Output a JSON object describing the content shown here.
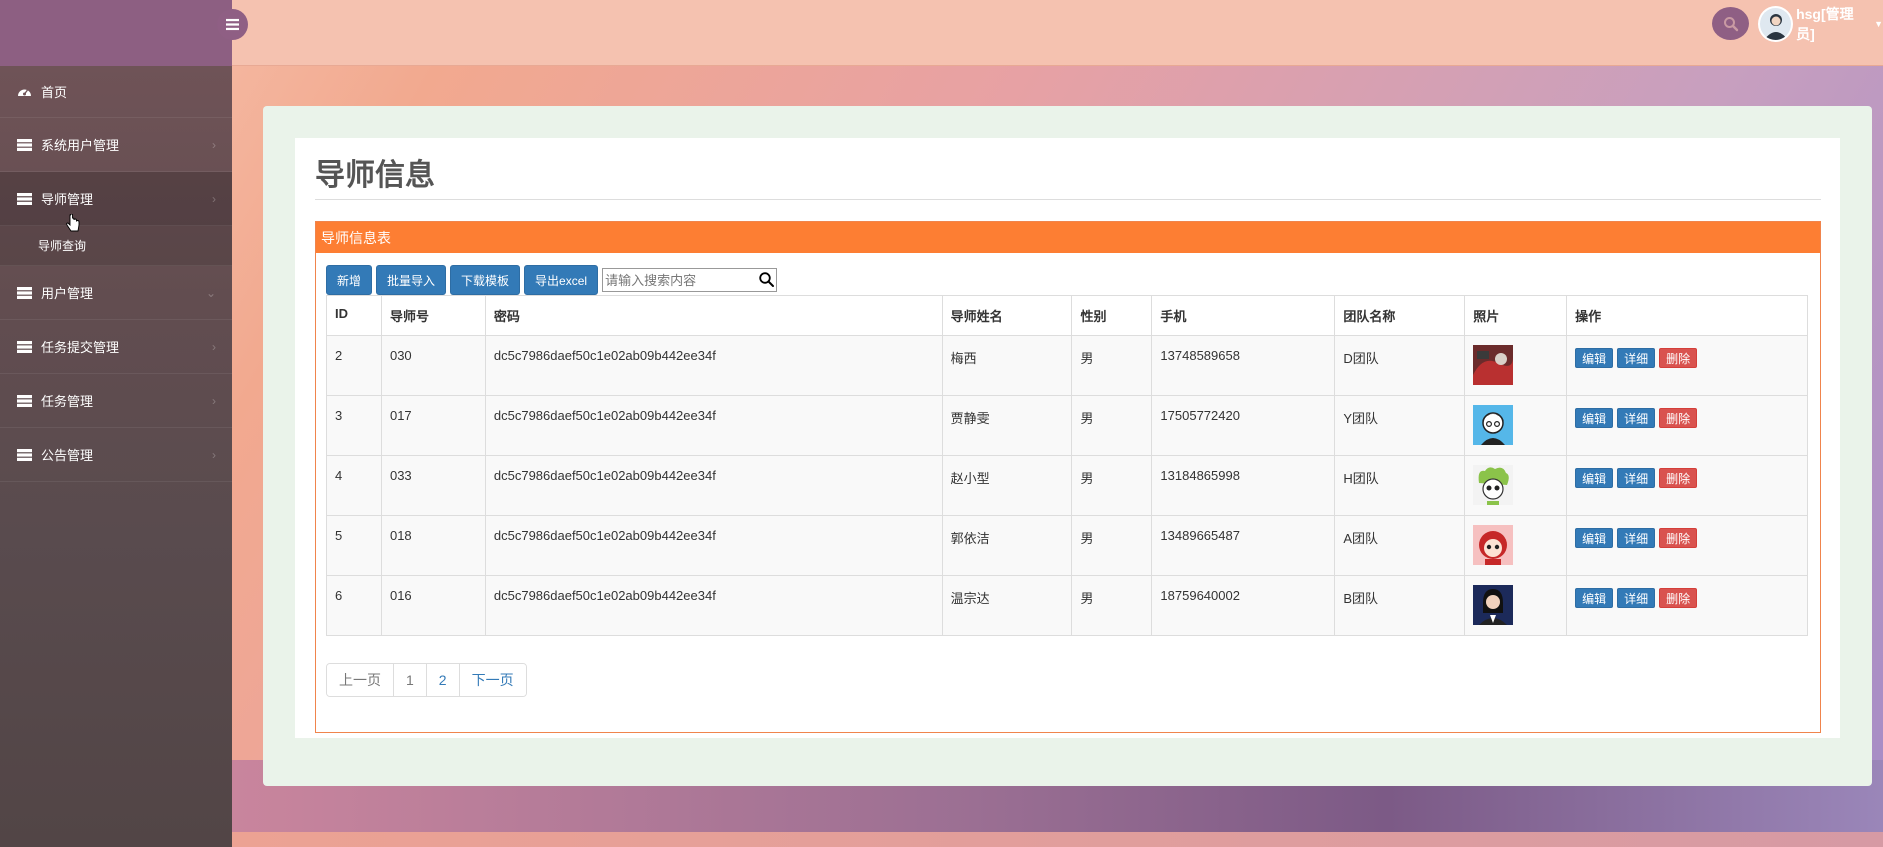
{
  "header": {
    "user_name": "hsg[管理员]"
  },
  "sidebar": {
    "items": [
      {
        "label": "首页",
        "icon": "dashboard-icon"
      },
      {
        "label": "系统用户管理",
        "icon": "server-icon"
      },
      {
        "label": "导师管理",
        "icon": "server-icon"
      },
      {
        "label": "用户管理",
        "icon": "server-icon"
      },
      {
        "label": "任务提交管理",
        "icon": "server-icon"
      },
      {
        "label": "任务管理",
        "icon": "server-icon"
      },
      {
        "label": "公告管理",
        "icon": "server-icon"
      }
    ],
    "sub_item": "导师查询"
  },
  "page": {
    "title": "导师信息",
    "panel_title": "导师信息表"
  },
  "toolbar": {
    "add": "新增",
    "batch_import": "批量导入",
    "download_template": "下载模板",
    "export_excel": "导出excel",
    "search_placeholder": "请输入搜索内容"
  },
  "table": {
    "headers": [
      "ID",
      "导师号",
      "密码",
      "导师姓名",
      "性别",
      "手机",
      "团队名称",
      "照片",
      "操作"
    ],
    "rows": [
      {
        "id": "2",
        "no": "030",
        "pwd": "dc5c7986daef50c1e02ab09b442ee34f",
        "name": "梅西",
        "sex": "男",
        "phone": "13748589658",
        "team": "D团队"
      },
      {
        "id": "3",
        "no": "017",
        "pwd": "dc5c7986daef50c1e02ab09b442ee34f",
        "name": "贾静雯",
        "sex": "男",
        "phone": "17505772420",
        "team": "Y团队"
      },
      {
        "id": "4",
        "no": "033",
        "pwd": "dc5c7986daef50c1e02ab09b442ee34f",
        "name": "赵小型",
        "sex": "男",
        "phone": "13184865998",
        "team": "H团队"
      },
      {
        "id": "5",
        "no": "018",
        "pwd": "dc5c7986daef50c1e02ab09b442ee34f",
        "name": "郭依洁",
        "sex": "男",
        "phone": "13489665487",
        "team": "A团队"
      },
      {
        "id": "6",
        "no": "016",
        "pwd": "dc5c7986daef50c1e02ab09b442ee34f",
        "name": "温宗达",
        "sex": "男",
        "phone": "18759640002",
        "team": "B团队"
      }
    ],
    "ops": {
      "edit": "编辑",
      "detail": "详细",
      "delete": "删除"
    }
  },
  "pagination": {
    "prev": "上一页",
    "pages": [
      "1",
      "2"
    ],
    "next": "下一页"
  }
}
